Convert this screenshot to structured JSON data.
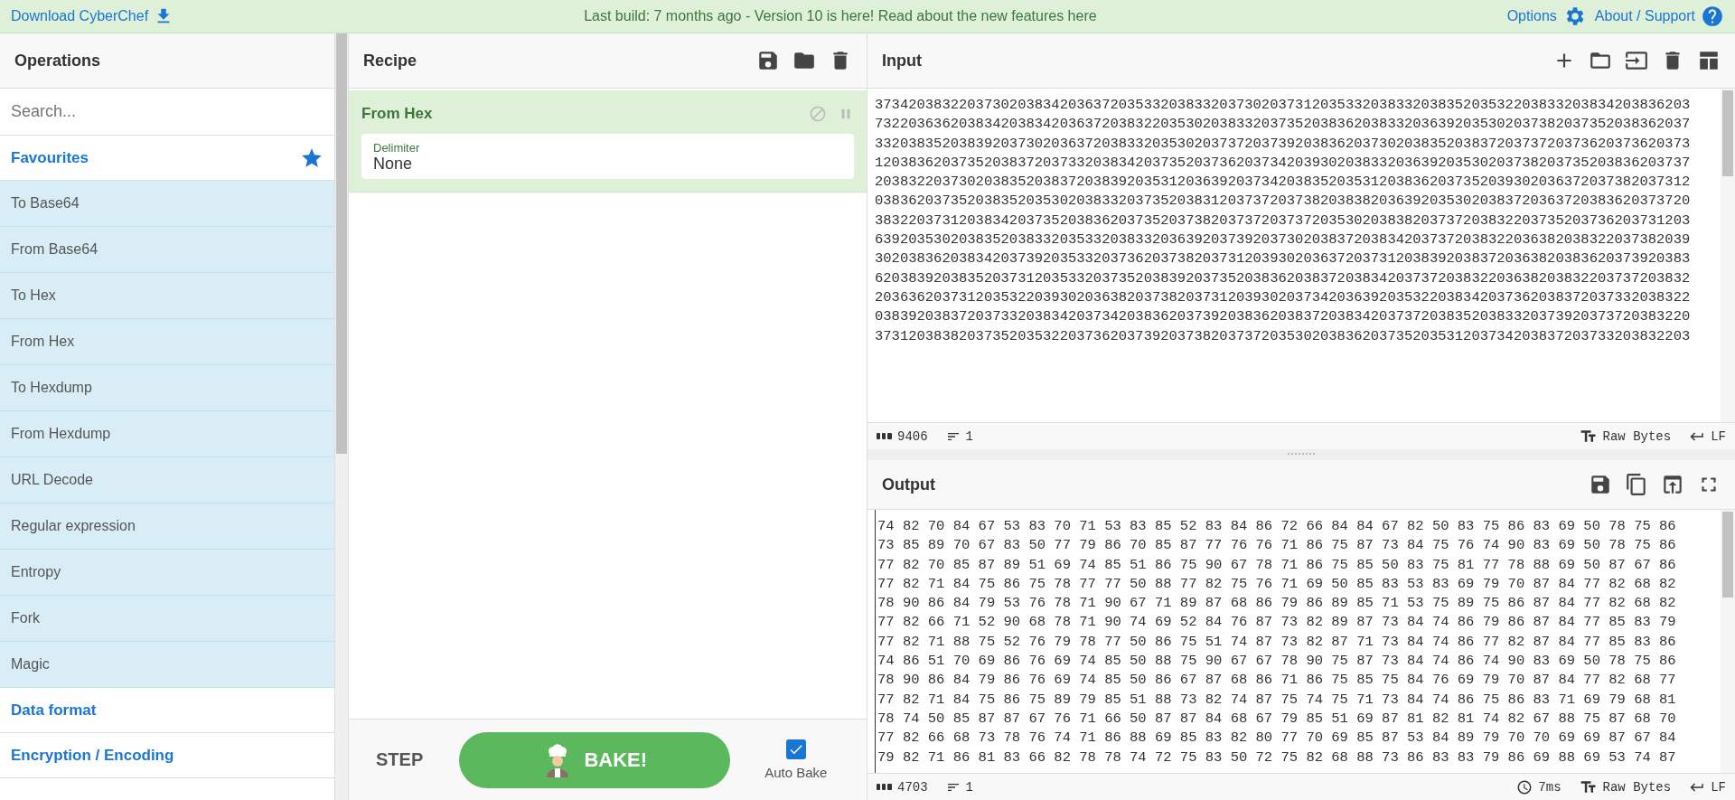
{
  "top_bar": {
    "download": "Download CyberChef",
    "notice": "Last build: 7 months ago - Version 10 is here! Read about the new features here",
    "options": "Options",
    "about": "About / Support"
  },
  "operations": {
    "title": "Operations",
    "search": {
      "placeholder": "Search..."
    },
    "categories": [
      {
        "label": "Favourites",
        "kind": "favourites",
        "items": [
          "To Base64",
          "From Base64",
          "To Hex",
          "From Hex",
          "To Hexdump",
          "From Hexdump",
          "URL Decode",
          "Regular expression",
          "Entropy",
          "Fork",
          "Magic"
        ]
      },
      {
        "label": "Data format",
        "kind": "category"
      },
      {
        "label": "Encryption / Encoding",
        "kind": "category"
      }
    ]
  },
  "recipe": {
    "title": "Recipe",
    "steps": [
      {
        "name": "From Hex",
        "disabled": false,
        "args": [
          {
            "label": "Delimiter",
            "value": "None"
          }
        ]
      }
    ],
    "step_button": "STEP",
    "bake_button": "BAKE!",
    "auto_bake": {
      "label": "Auto Bake",
      "checked": true
    }
  },
  "input": {
    "title": "Input",
    "lines": [
      "3734203832203730203834203637203533203833203730203731203533203833203835203532203833203834203836203",
      "7322036362038342038342036372038322035302038332037352038362038332036392035302037382037352038362037",
      "3320383520383920373020363720383320353020373720373920383620373020383520383720373720373620373620373",
      "1203836203735203837203733203834203735203736203734203930203833203639203530203738203735203836203737",
      "2038322037302038352038372038392035312036392037342038352035312038362037352039302036372037382037312",
      "0383620373520383520353020383320373520383120373720373820383820363920353020383720363720383620373720",
      "3832203731203834203735203836203735203738203737203737203530203838203737203832203735203736203731203",
      "6392035302038352038332035332038332036392037392037302038372038342037372038322036382038322037382039",
      "3020383620383420373920353320373620373820373120393020363720373120383920383720363820383620373920383",
      "6203839203835203731203533203735203839203735203836203837203834203737203832203638203832203737203832",
      "2036362037312035322039302036382037382037312039302037342036392035322038342037362038372037332038322",
      "0383920383720373320383420373420383620373920383620383720383420373720383520383320373920373720383220",
      "3731203838203735203532203736203739203738203737203530203836203735203531203734203837203733203832203"
    ],
    "length": "9406",
    "line_count": "1",
    "encoding": "Raw Bytes",
    "eol": "LF"
  },
  "output": {
    "title": "Output",
    "lines": [
      "74 82 70 84 67 53 83 70 71 53 83 85 52 83 84 86 72 66 84 84 67 82 50 83 75 86 83 69 50 78 75 86",
      "73 85 89 70 67 83 50 77 79 86 70 85 87 77 76 76 71 86 75 87 73 84 75 76 74 90 83 69 50 78 75 86",
      "77 82 70 85 87 89 51 69 74 85 51 86 75 90 67 78 71 86 75 85 50 83 75 81 77 78 88 69 50 87 67 86",
      "77 82 71 84 75 86 75 78 77 77 50 88 77 82 75 76 71 69 50 85 83 53 83 69 79 70 87 84 77 82 68 82",
      "78 90 86 84 79 53 76 78 71 90 67 71 89 87 68 86 79 86 89 85 71 53 75 89 75 86 87 84 77 82 68 82",
      "77 82 66 71 52 90 68 78 71 90 74 69 52 84 76 87 73 82 89 87 73 84 74 86 79 86 87 84 77 85 83 79",
      "77 82 71 88 75 52 76 79 78 77 50 86 75 51 74 87 73 82 87 71 73 84 74 86 77 82 87 84 77 85 83 86",
      "74 86 51 70 69 86 76 69 74 85 50 88 75 90 67 67 78 90 75 87 73 84 74 86 74 90 83 69 50 78 75 86",
      "78 90 86 84 79 86 76 69 74 85 50 86 67 87 68 86 71 86 75 85 75 84 76 69 79 70 87 84 77 82 68 77",
      "77 82 71 84 75 86 75 89 79 85 51 88 73 82 74 87 75 74 75 71 73 84 74 86 75 86 83 71 69 79 68 81",
      "78 74 50 85 87 87 67 76 71 66 50 87 87 84 68 67 79 85 51 69 87 81 82 81 74 82 67 88 75 87 68 70",
      "77 82 66 68 73 78 76 74 71 86 88 69 85 83 82 80 77 70 69 85 87 53 84 89 79 70 70 69 69 87 67 84",
      "79 82 71 86 81 83 66 82 78 78 74 72 75 83 50 72 75 82 68 88 73 86 83 83 79 86 69 88 69 53 74 87"
    ],
    "length": "4703",
    "line_count": "1",
    "time": "7ms",
    "encoding": "Raw Bytes",
    "eol": "LF"
  }
}
